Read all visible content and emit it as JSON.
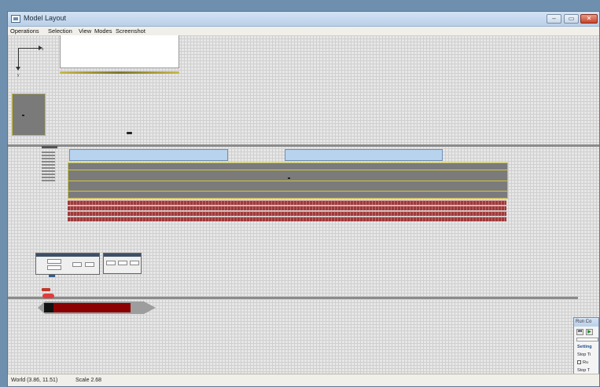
{
  "window": {
    "title": "Model Layout",
    "controls": [
      "minimize",
      "maximize",
      "close"
    ]
  },
  "menu": {
    "items": [
      "Operations",
      "Selection",
      "View",
      "Modes",
      "Screenshot"
    ]
  },
  "axes": {
    "x_label": "x",
    "y_label": "y"
  },
  "status": {
    "world": "World (3.86, 11.51)",
    "scale": "Scale 2.68"
  },
  "run_control": {
    "title": "Run Co",
    "settings": "Setting",
    "stop_label": "Stop Ti",
    "checkbox_label": "Ru",
    "stop_label2": "Stop T"
  },
  "colors": {
    "lane": "#b7d3ee",
    "slab": "#7b7b7b",
    "rows": "#9e3a3a",
    "gauge": "#8b0000",
    "accent_line": "#d0c83a"
  }
}
